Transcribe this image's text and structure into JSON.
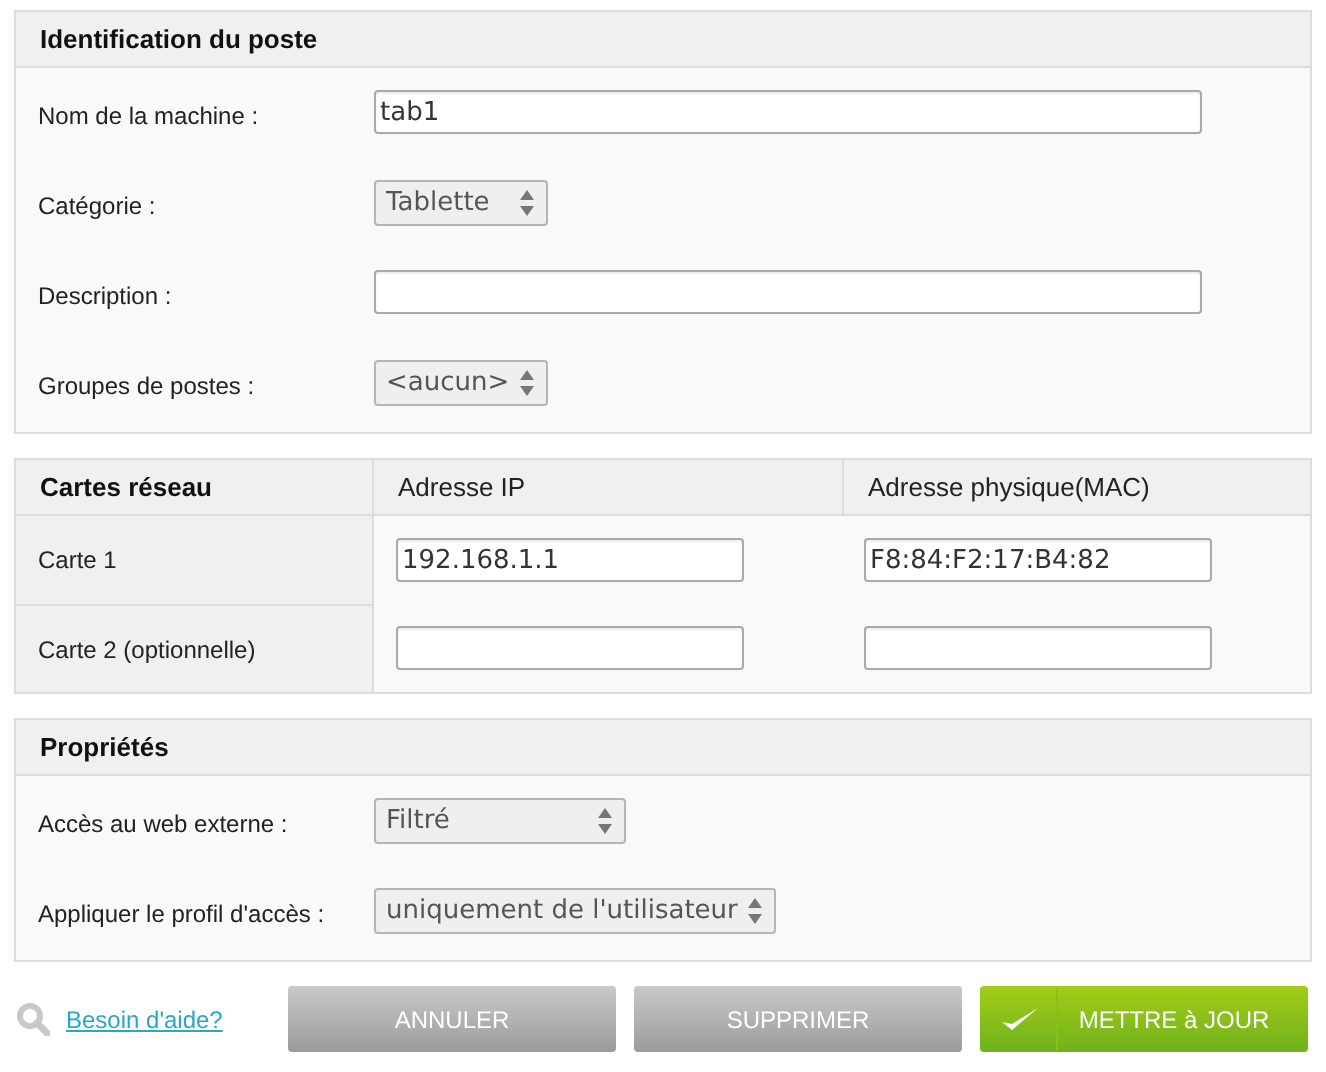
{
  "identification": {
    "title": "Identification du poste",
    "fields": [
      {
        "label": "Nom de la machine :",
        "kind": "text",
        "value": "tab1"
      },
      {
        "label": "Catégorie :",
        "kind": "select",
        "value": "Tablette"
      },
      {
        "label": "Description :",
        "kind": "text"
      },
      {
        "label": "Groupes de postes :",
        "kind": "select",
        "value": "<aucun>"
      }
    ]
  },
  "network": {
    "columns": [
      "Cartes réseau",
      "Adresse IP",
      "Adresse physique(MAC)"
    ],
    "rows": [
      {
        "label": "Carte 1",
        "ip": "192.168.1.1",
        "mac": "F8:84:F2:17:B4:82"
      },
      {
        "label": "Carte 2 (optionnelle)"
      }
    ]
  },
  "properties": {
    "title": "Propriétés",
    "fields": [
      {
        "label": "Accès au web externe :",
        "kind": "select",
        "value": "Filtré"
      },
      {
        "label": "Appliquer le profil d'accès :",
        "kind": "select",
        "value": "uniquement de l'utilisateur"
      }
    ]
  },
  "footer": {
    "help_link": "Besoin d'aide?",
    "buttons": [
      {
        "label": "ANNULER",
        "kind": "secondary"
      },
      {
        "label": "SUPPRIMER",
        "kind": "secondary"
      },
      {
        "label": "METTRE à JOUR",
        "kind": "primary"
      }
    ]
  }
}
